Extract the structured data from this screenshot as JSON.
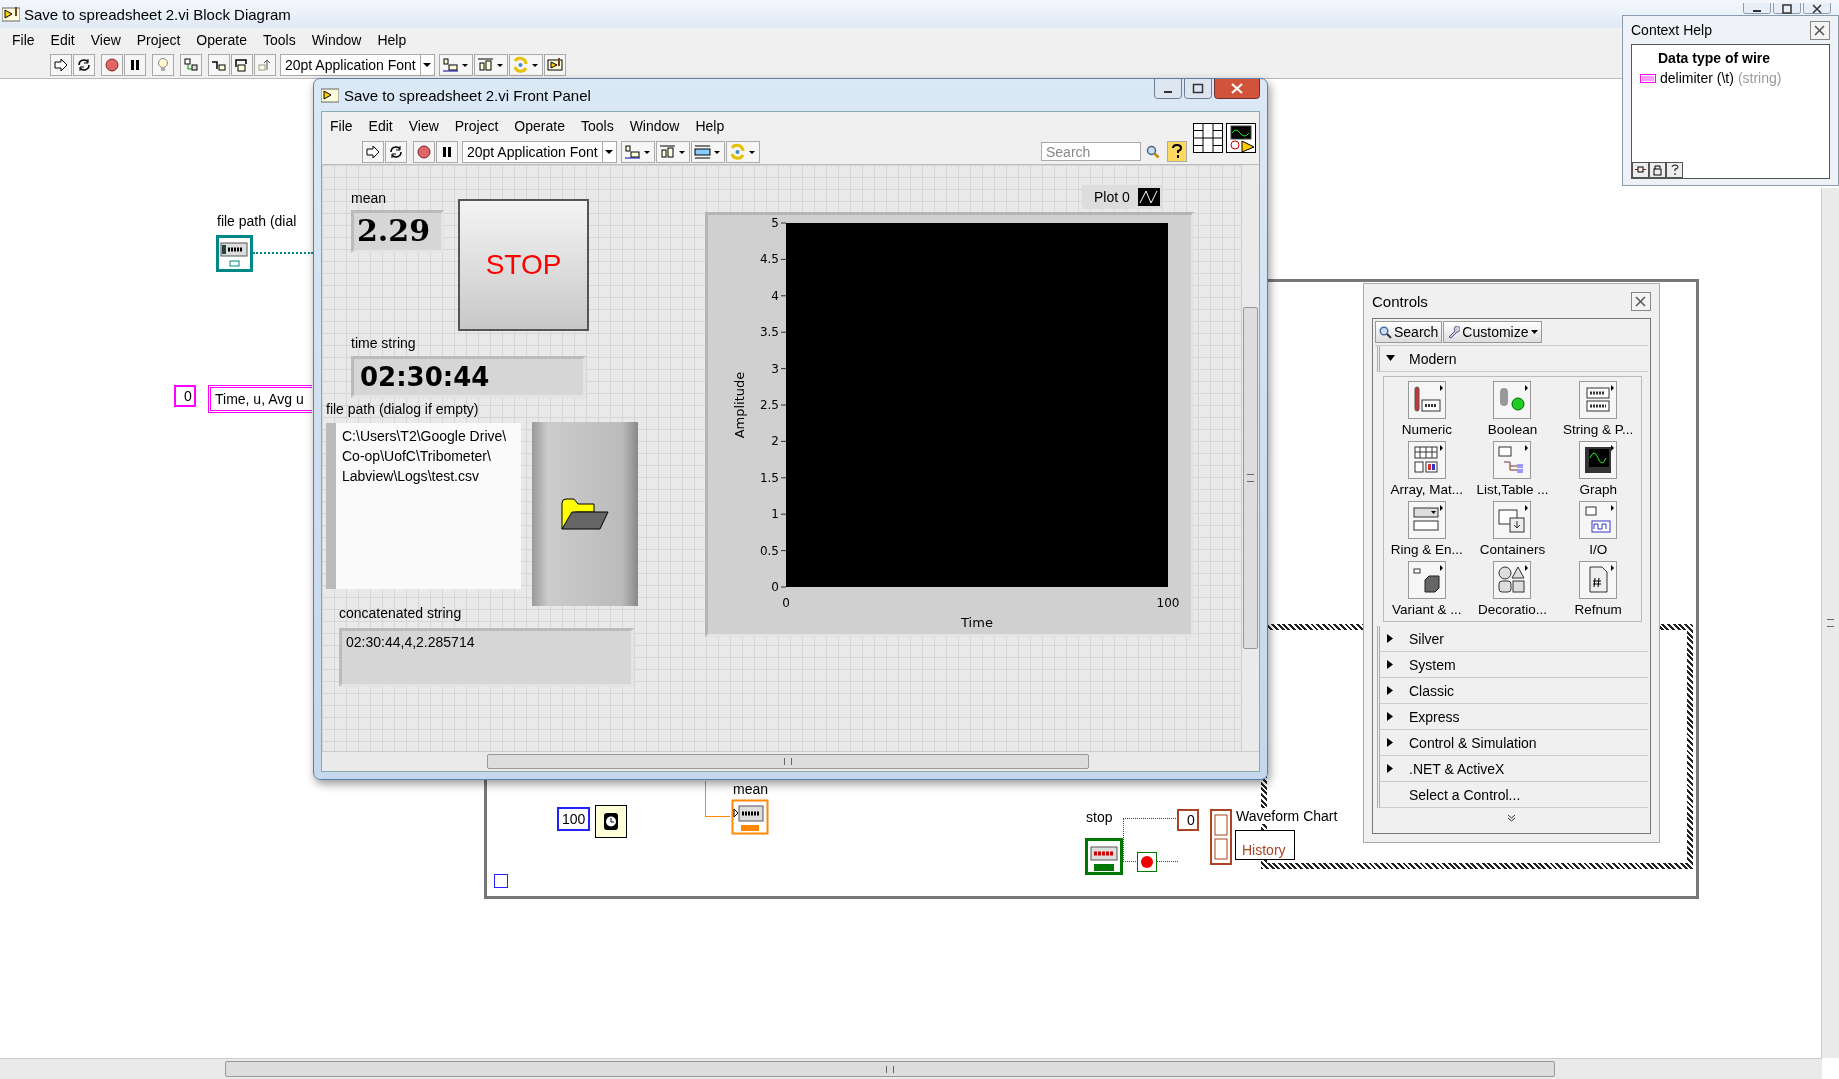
{
  "diagram_window": {
    "title": "Save to spreadsheet 2.vi Block Diagram",
    "menu": [
      "File",
      "Edit",
      "View",
      "Project",
      "Operate",
      "Tools",
      "Window",
      "Help"
    ],
    "font_selector": "20pt Application Font",
    "nodes": {
      "file_path_label": "file path (dial",
      "array_index": "0",
      "string_constant": "Time, u, Avg u",
      "wait_constant": "100",
      "mean_label": "mean",
      "stop_label": "stop",
      "chart_index": "0",
      "chart_label": "Waveform Chart",
      "history_label": "History"
    }
  },
  "front_panel": {
    "title": "Save to spreadsheet 2.vi Front Panel",
    "menu": [
      "File",
      "Edit",
      "View",
      "Project",
      "Operate",
      "Tools",
      "Window",
      "Help"
    ],
    "font_selector": "20pt Application Font",
    "search": {
      "placeholder": "Search"
    },
    "mean": {
      "label": "mean",
      "value": "2.29"
    },
    "stop_button": "STOP",
    "time_string": {
      "label": "time string",
      "value": "02:30:44"
    },
    "file_path": {
      "label": "file path (dialog if empty)",
      "value": "C:\\Users\\T2\\Google Drive\\Co-op\\UofC\\Tribometer\\Labview\\Logs\\test.csv"
    },
    "concatenated_string": {
      "label": "concatenated string",
      "value": "02:30:44,4,2.285714"
    },
    "chart": {
      "legend": "Plot 0",
      "chart_data": {
        "type": "line",
        "xlabel": "Time",
        "ylabel": "Amplitude",
        "xlim": [
          0,
          100
        ],
        "ylim": [
          0,
          5
        ],
        "xticks": [
          0,
          100
        ],
        "yticks": [
          0,
          0.5,
          1,
          1.5,
          2,
          2.5,
          3,
          3.5,
          4,
          4.5,
          5
        ]
      }
    }
  },
  "context_help": {
    "title": "Context Help",
    "heading": "Data type of wire",
    "wire_name": "delimiter (\\t)",
    "wire_type": "(string)"
  },
  "controls_palette": {
    "title": "Controls",
    "search_button": "Search",
    "customize_button": "Customize",
    "categories": [
      {
        "label": "Modern",
        "expanded": true,
        "items": [
          {
            "label": "Numeric",
            "kind": "numeric"
          },
          {
            "label": "Boolean",
            "kind": "boolean"
          },
          {
            "label": "String & P...",
            "kind": "string"
          },
          {
            "label": "Array, Mat...",
            "kind": "array"
          },
          {
            "label": "List,Table ...",
            "kind": "list"
          },
          {
            "label": "Graph",
            "kind": "graph"
          },
          {
            "label": "Ring & En...",
            "kind": "ring"
          },
          {
            "label": "Containers",
            "kind": "containers"
          },
          {
            "label": "I/O",
            "kind": "io"
          },
          {
            "label": "Variant & ...",
            "kind": "variant"
          },
          {
            "label": "Decoratio...",
            "kind": "decorations"
          },
          {
            "label": "Refnum",
            "kind": "refnum"
          }
        ]
      },
      {
        "label": "Silver",
        "expanded": false
      },
      {
        "label": "System",
        "expanded": false
      },
      {
        "label": "Classic",
        "expanded": false
      },
      {
        "label": "Express",
        "expanded": false
      },
      {
        "label": "Control & Simulation",
        "expanded": false
      },
      {
        "label": ".NET & ActiveX",
        "expanded": false
      }
    ],
    "select_control": "Select a Control..."
  }
}
